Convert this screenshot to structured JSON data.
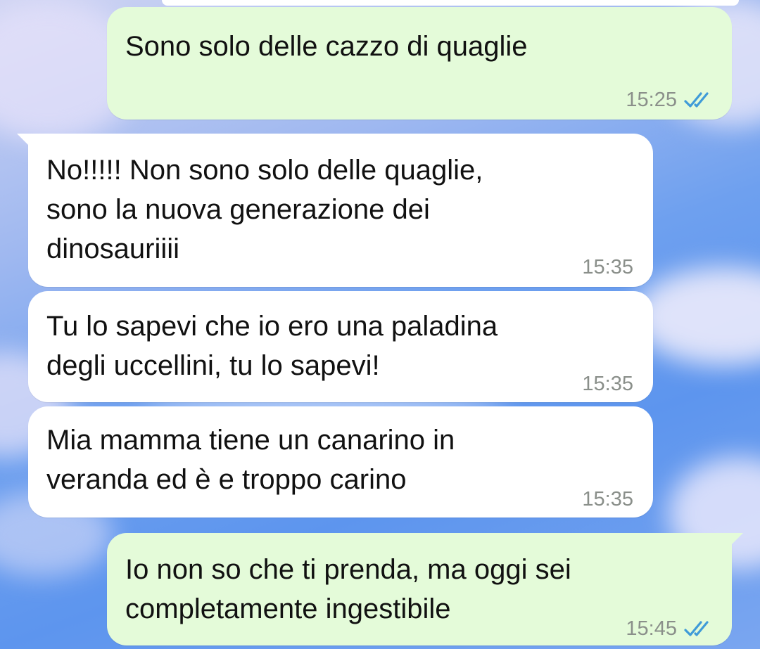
{
  "colors": {
    "incoming_bubble": "#ffffff",
    "outgoing_bubble": "#e4fbd9",
    "read_tick": "#3f9bd8",
    "timestamp": "#8a8f8a"
  },
  "messages": [
    {
      "direction": "outgoing",
      "text": "Sono solo delle cazzo di quaglie",
      "time": "15:25",
      "status": "read-double-check-icon"
    },
    {
      "direction": "incoming",
      "text": "No!!!!! Non sono solo delle quaglie,\nsono la nuova generazione dei\ndinosauriiii",
      "time": "15:35"
    },
    {
      "direction": "incoming",
      "text": "Tu lo sapevi che io ero una paladina\ndegli uccellini, tu lo sapevi!",
      "time": "15:35"
    },
    {
      "direction": "incoming",
      "text": "Mia mamma tiene un canarino in\nveranda ed è e troppo carino",
      "time": "15:35"
    },
    {
      "direction": "outgoing",
      "text": "Io non so che ti prenda, ma oggi sei\ncompletamente ingestibile",
      "time": "15:45",
      "status": "read-double-check-icon"
    }
  ]
}
